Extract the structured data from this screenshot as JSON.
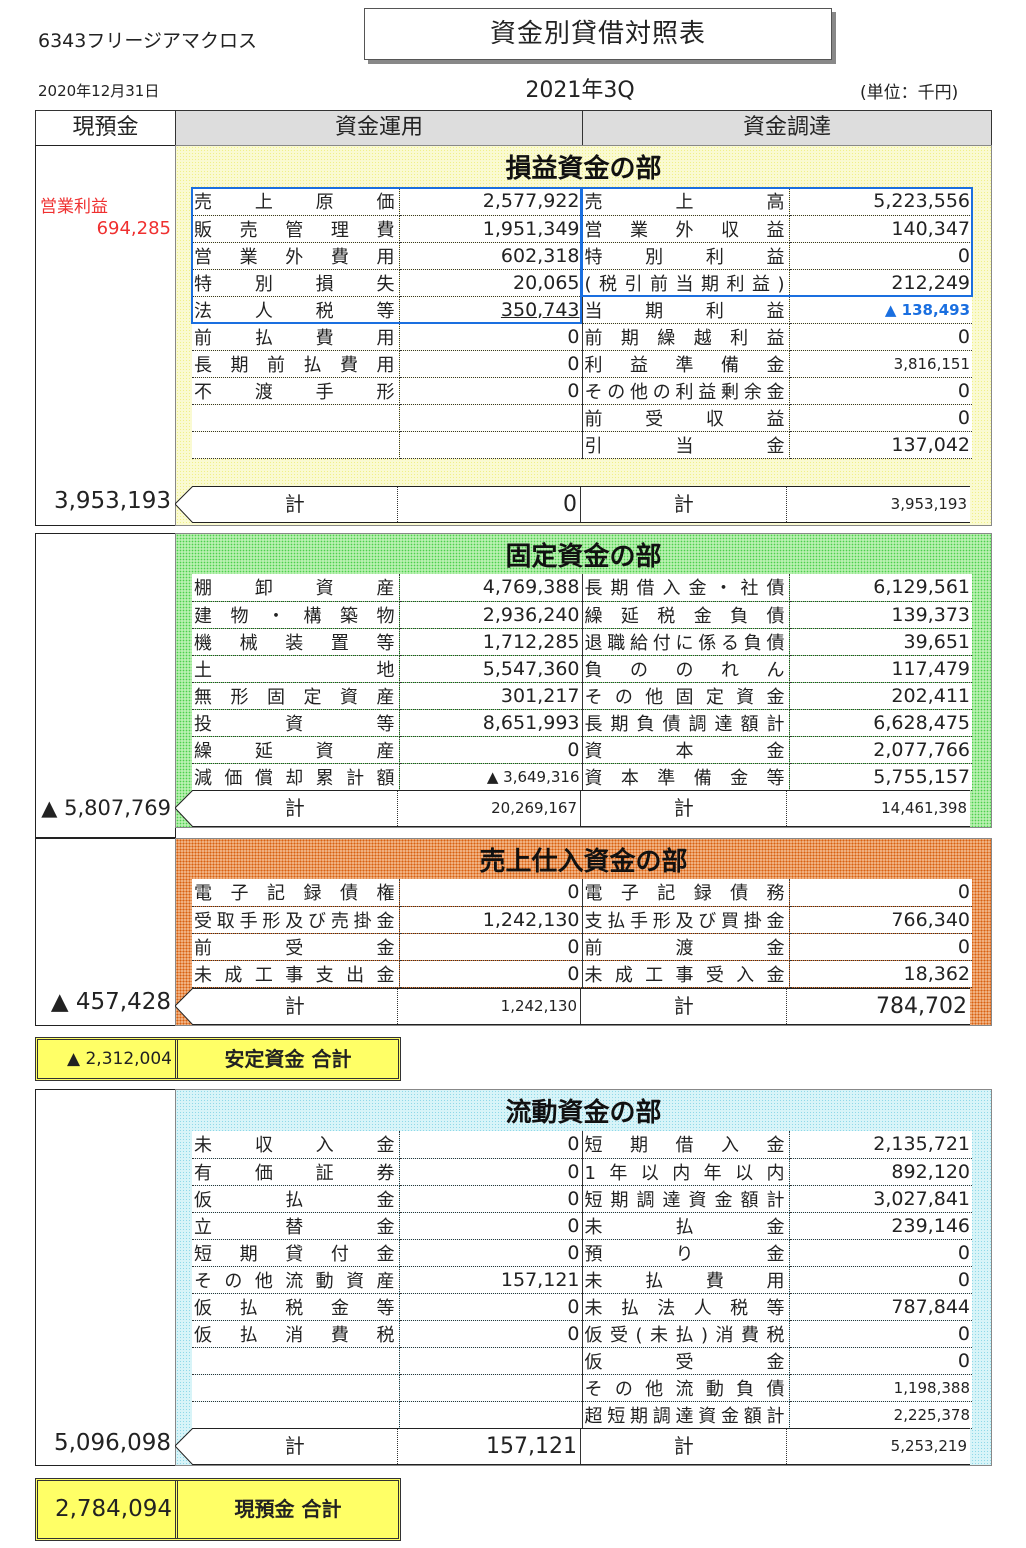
{
  "header": {
    "company": "6343フリージアマクロス",
    "title": "資金別貸借対照表",
    "date": "2020年12月31日",
    "period": "2021年3Q",
    "unit": "(単位：千円)",
    "col_cash": "現預金",
    "col_use": "資金運用",
    "col_source": "資金調達"
  },
  "colors": {
    "pl_section": "#fafad2",
    "fixed_section": "#b8f0b0",
    "sales_section": "#f0b080",
    "current_section": "#d8f4f8",
    "total_box": "#ffff66",
    "accent_blue": "#1a6fe0",
    "accent_red": "#ef3030"
  },
  "pl": {
    "title": "損益資金の部",
    "op_profit_label": "営業利益",
    "op_profit_value": "694,285",
    "cash_total": "3,953,193",
    "use": [
      {
        "label": "売上原価",
        "value": "2,577,922"
      },
      {
        "label": "販売管理費",
        "value": "1,951,349"
      },
      {
        "label": "営業外費用",
        "value": "602,318"
      },
      {
        "label": "特別損失",
        "value": "20,065"
      },
      {
        "label": "法人税等",
        "value": "350,743"
      },
      {
        "label": "前払費用",
        "value": "0"
      },
      {
        "label": "長期前払費用",
        "value": "0"
      },
      {
        "label": "不渡手形",
        "value": "0"
      },
      {
        "label": "",
        "value": ""
      },
      {
        "label": "",
        "value": ""
      }
    ],
    "source": [
      {
        "label": "売上高",
        "value": "5,223,556"
      },
      {
        "label": "営業外収益",
        "value": "140,347"
      },
      {
        "label": "特別利益",
        "value": "0"
      },
      {
        "label": "(税引前当期利益)",
        "value": "212,249"
      },
      {
        "label": "当期利益",
        "value": "▲ 138,493"
      },
      {
        "label": "前期繰越利益",
        "value": "0"
      },
      {
        "label": "利益準備金",
        "value": "3,816,151"
      },
      {
        "label": "その他の利益剰余金",
        "value": "0"
      },
      {
        "label": "前受収益",
        "value": "0"
      },
      {
        "label": "引当金",
        "value": "137,042"
      }
    ],
    "sum_label": "計",
    "use_total": "0",
    "source_total": "3,953,193"
  },
  "fixed": {
    "title": "固定資金の部",
    "cash_total": "▲ 5,807,769",
    "use": [
      {
        "label": "棚卸資産",
        "value": "4,769,388"
      },
      {
        "label": "建物・構築物",
        "value": "2,936,240"
      },
      {
        "label": "機械装置等",
        "value": "1,712,285"
      },
      {
        "label": "土地",
        "value": "5,547,360"
      },
      {
        "label": "無形固定資産",
        "value": "301,217"
      },
      {
        "label": "投資等",
        "value": "8,651,993"
      },
      {
        "label": "繰延資産",
        "value": "0"
      },
      {
        "label": "減価償却累計額",
        "value": "▲ 3,649,316"
      }
    ],
    "source": [
      {
        "label": "長期借入金・社債",
        "value": "6,129,561"
      },
      {
        "label": "繰延税金負債",
        "value": "139,373"
      },
      {
        "label": "退職給付に係る負債",
        "value": "39,651"
      },
      {
        "label": "負ののれん",
        "value": "117,479"
      },
      {
        "label": "その他固定資金",
        "value": "202,411"
      },
      {
        "label": "長期負債調達額計",
        "value": "6,628,475"
      },
      {
        "label": "資本金",
        "value": "2,077,766"
      },
      {
        "label": "資本準備金等",
        "value": "5,755,157"
      }
    ],
    "sum_label": "計",
    "use_total": "20,269,167",
    "source_total": "14,461,398"
  },
  "sales": {
    "title": "売上仕入資金の部",
    "cash_total": "▲ 457,428",
    "use": [
      {
        "label": "電子記録債権",
        "value": "0"
      },
      {
        "label": "受取手形及び売掛金",
        "value": "1,242,130"
      },
      {
        "label": "前受金",
        "value": "0"
      },
      {
        "label": "未成工事支出金",
        "value": "0"
      }
    ],
    "source": [
      {
        "label": "電子記録債務",
        "value": "0"
      },
      {
        "label": "支払手形及び買掛金",
        "value": "766,340"
      },
      {
        "label": "前渡金",
        "value": "0"
      },
      {
        "label": "未成工事受入金",
        "value": "18,362"
      }
    ],
    "sum_label": "計",
    "use_total": "1,242,130",
    "source_total": "784,702"
  },
  "stable_total": {
    "value": "▲ 2,312,004",
    "label": "安定資金 合計"
  },
  "current": {
    "title": "流動資金の部",
    "cash_total": "5,096,098",
    "use": [
      {
        "label": "未収入金",
        "value": "0"
      },
      {
        "label": "有価証券",
        "value": "0"
      },
      {
        "label": "仮払金",
        "value": "0"
      },
      {
        "label": "立替金",
        "value": "0"
      },
      {
        "label": "短期貸付金",
        "value": "0"
      },
      {
        "label": "その他流動資産",
        "value": "157,121"
      },
      {
        "label": "仮払税金等",
        "value": "0"
      },
      {
        "label": "仮払消費税",
        "value": "0"
      },
      {
        "label": "",
        "value": ""
      },
      {
        "label": "",
        "value": ""
      },
      {
        "label": "",
        "value": ""
      }
    ],
    "source": [
      {
        "label": "短期借入金",
        "value": "2,135,721"
      },
      {
        "label": "1年以内年以内",
        "value": "892,120"
      },
      {
        "label": "短期調達資金額計",
        "value": "3,027,841"
      },
      {
        "label": "未払金",
        "value": "239,146"
      },
      {
        "label": "預り金",
        "value": "0"
      },
      {
        "label": "未払費用",
        "value": "0"
      },
      {
        "label": "未払法人税等",
        "value": "787,844"
      },
      {
        "label": "仮受(未払)消費税",
        "value": "0"
      },
      {
        "label": "仮受金",
        "value": "0"
      },
      {
        "label": "その他流動負債",
        "value": "1,198,388"
      },
      {
        "label": "超短期調達資金額計",
        "value": "2,225,378"
      }
    ],
    "sum_label": "計",
    "use_total": "157,121",
    "source_total": "5,253,219"
  },
  "cash_total": {
    "value": "2,784,094",
    "label": "現預金 合計"
  }
}
